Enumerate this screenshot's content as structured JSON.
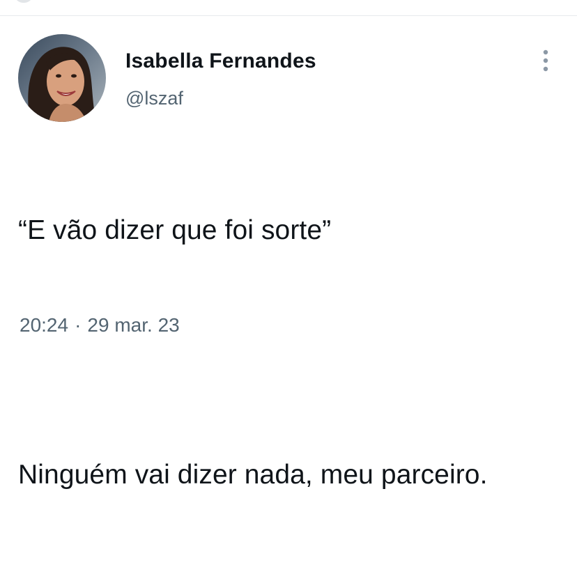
{
  "tweet": {
    "author": {
      "name": "Isabella Fernandes",
      "handle": "@lszaf"
    },
    "text": {
      "line1": "“E vão dizer que foi sorte”",
      "line2": "Ninguém vai dizer nada, meu parceiro."
    },
    "meta": {
      "time": "20:24",
      "separator": "·",
      "date": "29 mar. 23"
    },
    "icons": {
      "more": "more-vertical-icon"
    }
  },
  "colors": {
    "text_primary": "#0f1419",
    "text_secondary": "#536471",
    "divider": "#e6e9ec",
    "background": "#ffffff"
  }
}
